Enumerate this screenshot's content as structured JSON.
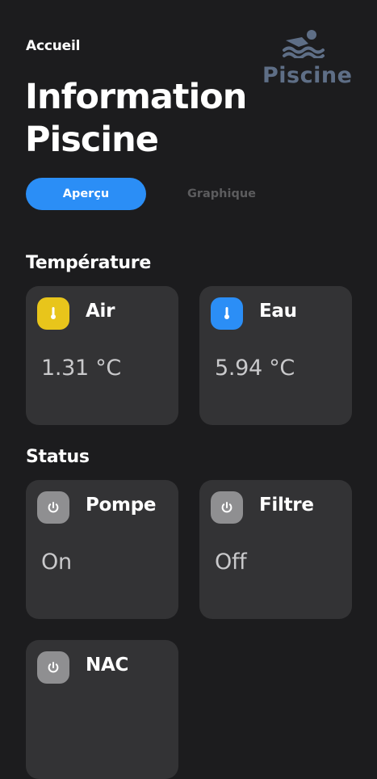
{
  "header": {
    "breadcrumb": "Accueil",
    "logo_text": "Piscine",
    "title": "Information Piscine"
  },
  "tabs": [
    {
      "label": "Aperçu",
      "active": true
    },
    {
      "label": "Graphique",
      "active": false
    }
  ],
  "temperature": {
    "title": "Température",
    "cards": [
      {
        "label": "Air",
        "value": "1.31 °C",
        "icon": "thermometer-icon",
        "color": "#e8c51b"
      },
      {
        "label": "Eau",
        "value": "5.94 °C",
        "icon": "thermometer-icon",
        "color": "#2b8ef6"
      }
    ]
  },
  "status": {
    "title": "Status",
    "cards": [
      {
        "label": "Pompe",
        "value": "On",
        "icon": "power-icon",
        "color": "#8f8f91"
      },
      {
        "label": "Filtre",
        "value": "Off",
        "icon": "power-icon",
        "color": "#8f8f91"
      },
      {
        "label": "NAC",
        "value": "",
        "icon": "power-icon",
        "color": "#8f8f91"
      }
    ]
  },
  "colors": {
    "background": "#1c1c1e",
    "card": "#333335",
    "accent": "#2b8ef6",
    "logo": "#5e6e86"
  }
}
